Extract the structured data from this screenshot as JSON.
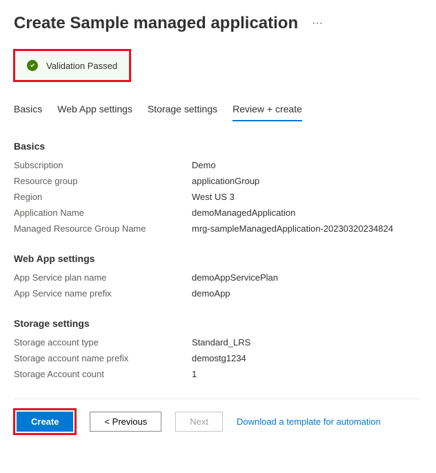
{
  "page_title": "Create Sample managed application",
  "validation_message": "Validation Passed",
  "tabs": {
    "basics": "Basics",
    "webapp": "Web App settings",
    "storage": "Storage settings",
    "review": "Review + create"
  },
  "sections": {
    "basics": {
      "title": "Basics",
      "subscription": {
        "label": "Subscription",
        "value": "Demo"
      },
      "resource_group": {
        "label": "Resource group",
        "value": "applicationGroup"
      },
      "region": {
        "label": "Region",
        "value": "West US 3"
      },
      "app_name": {
        "label": "Application Name",
        "value": "demoManagedApplication"
      },
      "mrg_name": {
        "label": "Managed Resource Group Name",
        "value": "mrg-sampleManagedApplication-20230320234824"
      }
    },
    "webapp": {
      "title": "Web App settings",
      "plan_name": {
        "label": "App Service plan name",
        "value": "demoAppServicePlan"
      },
      "name_prefix": {
        "label": "App Service name prefix",
        "value": "demoApp"
      }
    },
    "storage": {
      "title": "Storage settings",
      "account_type": {
        "label": "Storage account type",
        "value": "Standard_LRS"
      },
      "name_prefix": {
        "label": "Storage account name prefix",
        "value": "demostg1234"
      },
      "account_count": {
        "label": "Storage Account count",
        "value": "1"
      }
    }
  },
  "footer": {
    "create": "Create",
    "previous": "< Previous",
    "next": "Next",
    "download": "Download a template for automation"
  }
}
